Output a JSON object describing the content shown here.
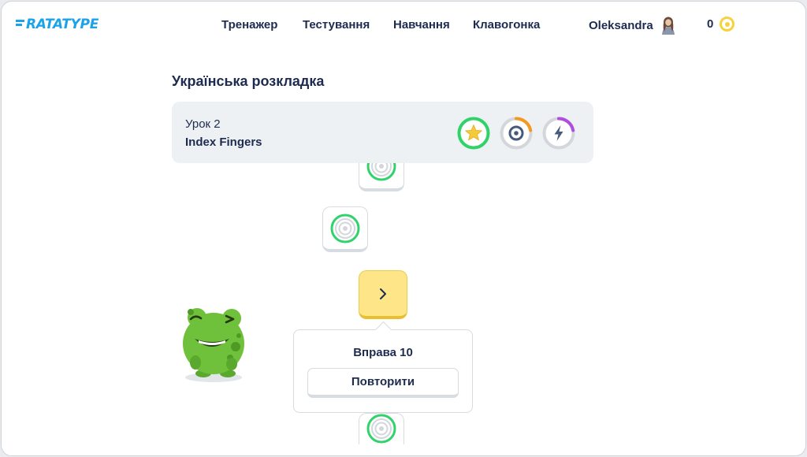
{
  "header": {
    "logo_text": "RATATYPE",
    "nav": [
      "Тренажер",
      "Тестування",
      "Навчання",
      "Клавогонка"
    ],
    "user_name": "Oleksandra",
    "coins": "0"
  },
  "page": {
    "title": "Українська розкладка"
  },
  "lesson": {
    "number_label": "Урок 2",
    "name": "Index Fingers",
    "badges": [
      "star-badge",
      "accuracy-badge",
      "speed-badge"
    ]
  },
  "popup": {
    "title": "Вправа 10",
    "button_label": "Повторити"
  },
  "colors": {
    "brand": "#1aa3e8",
    "text": "#1d2b4f",
    "success": "#2fd36a",
    "active_tile": "#fde588",
    "coin": "#f6d23b",
    "accuracy_ring": "#f39a1c",
    "speed_ring": "#b04de0"
  }
}
